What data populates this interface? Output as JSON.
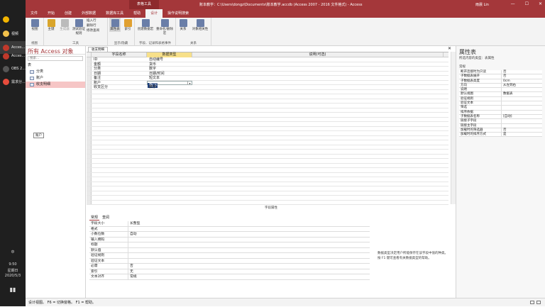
{
  "taskbar": {
    "apps": [
      {
        "label": "",
        "icon": "chrome-icon",
        "color": "#f2b400"
      },
      {
        "label": "视频",
        "icon": "folder-icon",
        "color": "#f3c14a"
      },
      {
        "label": "Acces...",
        "icon": "access-icon",
        "color": "#c0392b"
      },
      {
        "label": "Acces...",
        "icon": "access-icon",
        "color": "#c0392b"
      },
      {
        "label": "OBS 2...",
        "icon": "obs-icon",
        "color": "#555555"
      },
      {
        "label": "需求分...",
        "icon": "app-icon",
        "color": "#e74c3c"
      }
    ],
    "lang": "中",
    "time": "9:50",
    "weekday": "星期日",
    "date": "2020/5/3"
  },
  "titlebar": {
    "context_tab": "表格工具",
    "title": "账本教学：C:\\Users\\dongz\\Documents\\账本教学.accdb (Access 2007 - 2016 文件格式) - Access",
    "user": "雨晨 Lin",
    "controls": [
      "—",
      "☐",
      "✕"
    ]
  },
  "menu": [
    "文件",
    "开始",
    "创建",
    "外部数据",
    "数据库工具",
    "帮助",
    "设计",
    "操作说明搜索"
  ],
  "menu_selected_index": 6,
  "ribbon": {
    "groups": [
      {
        "label": "视图",
        "buttons": [
          "视图"
        ]
      },
      {
        "label": "工具",
        "buttons": [
          "主键",
          "生成器",
          "测试验证规则"
        ],
        "small": [
          "插入行",
          "删除行",
          "修改查阅"
        ]
      },
      {
        "label": "显示/隐藏",
        "buttons": [
          "属性表",
          "索引"
        ]
      },
      {
        "label": "字段、记录和表格事件",
        "buttons": [
          "创建数据宏",
          "重命名/删除宏"
        ]
      },
      {
        "label": "关系",
        "buttons": [
          "关系",
          "对象相关性"
        ]
      }
    ]
  },
  "nav": {
    "title": "所有 Access 对象",
    "search_placeholder": "搜索...",
    "section": "表",
    "items": [
      "分类",
      "账户",
      "收支明细"
    ],
    "tooltip": "账户"
  },
  "document": {
    "tab": "收支明细",
    "columns": [
      "字段名称",
      "数据类型",
      "说明(可选)"
    ],
    "rows": [
      {
        "name": "ID",
        "type": "自动编号"
      },
      {
        "name": "金额",
        "type": "货币"
      },
      {
        "name": "分类",
        "type": "数字"
      },
      {
        "name": "日期",
        "type": "日期/时间"
      },
      {
        "name": "备注",
        "type": "短文本"
      },
      {
        "name": "账户",
        "type": "数字"
      },
      {
        "name": "收支区分",
        "type": "数字"
      }
    ],
    "field_props_title": "字段属性",
    "prop_tabs": [
      "常规",
      "查阅"
    ],
    "props": [
      [
        "字段大小",
        "长整型"
      ],
      [
        "格式",
        ""
      ],
      [
        "小数位数",
        "自动"
      ],
      [
        "输入掩码",
        ""
      ],
      [
        "标题",
        ""
      ],
      [
        "默认值",
        ""
      ],
      [
        "验证规则",
        ""
      ],
      [
        "验证文本",
        ""
      ],
      [
        "必需",
        "否"
      ],
      [
        "索引",
        "无"
      ],
      [
        "文本对齐",
        "常规"
      ]
    ],
    "help": "数据类型决定用户所能保存在该字段中值的种类。按 F1 键可查看有关数据类型的帮助。"
  },
  "property_sheet": {
    "title": "属性表",
    "subtitle": "所选内容的类型：表属性",
    "tab": "常规",
    "rows": [
      [
        "断开连接时为只读",
        "否"
      ],
      [
        "子数据表展开",
        "否"
      ],
      [
        "子数据表高度",
        "0cm"
      ],
      [
        "方向",
        "从左到右"
      ],
      [
        "说明",
        ""
      ],
      [
        "默认视图",
        "数据表"
      ],
      [
        "验证规则",
        ""
      ],
      [
        "验证文本",
        ""
      ],
      [
        "筛选",
        ""
      ],
      [
        "排序依据",
        ""
      ],
      [
        "子数据表名称",
        "[自动]"
      ],
      [
        "链接子字段",
        ""
      ],
      [
        "链接主字段",
        ""
      ],
      [
        "加载时的筛选器",
        "否"
      ],
      [
        "加载时的排序方式",
        "是"
      ]
    ]
  },
  "status": "设计视图。 F6 = 切换窗格。 F1 = 帮助。",
  "colors": {
    "accent": "#a4373a"
  }
}
